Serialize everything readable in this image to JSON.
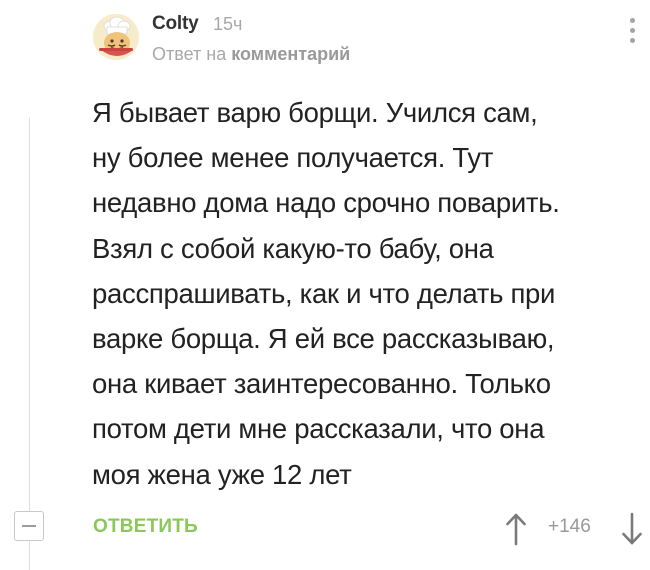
{
  "comment": {
    "author": "Colty",
    "time": "15ч",
    "reply_prefix": "Ответ на",
    "reply_link": "комментарий",
    "avatar_icon": "chef-avatar-icon",
    "more_icon": "more-vertical-icon",
    "lines": [
      "Я бывает варю борщи. Учился сам,",
      "ну более менее получается. Тут",
      "недавно дома надо срочно поварить.",
      "Взял с собой какую-то бабу, она",
      "расспрашивать, как и что делать при",
      "варке борща. Я ей все рассказываю,",
      "она кивает заинтересованно. Только",
      "потом дети мне рассказали, что она",
      "моя жена уже 12 лет"
    ]
  },
  "footer": {
    "collapse_icon": "minus-icon",
    "reply_label": "ОТВЕТИТЬ",
    "rating": "+146",
    "upvote_icon": "arrow-up-icon",
    "downvote_icon": "arrow-down-icon"
  },
  "colors": {
    "accent_green": "#8ac858",
    "muted_gray": "#a8a8a8",
    "text": "#222222"
  }
}
